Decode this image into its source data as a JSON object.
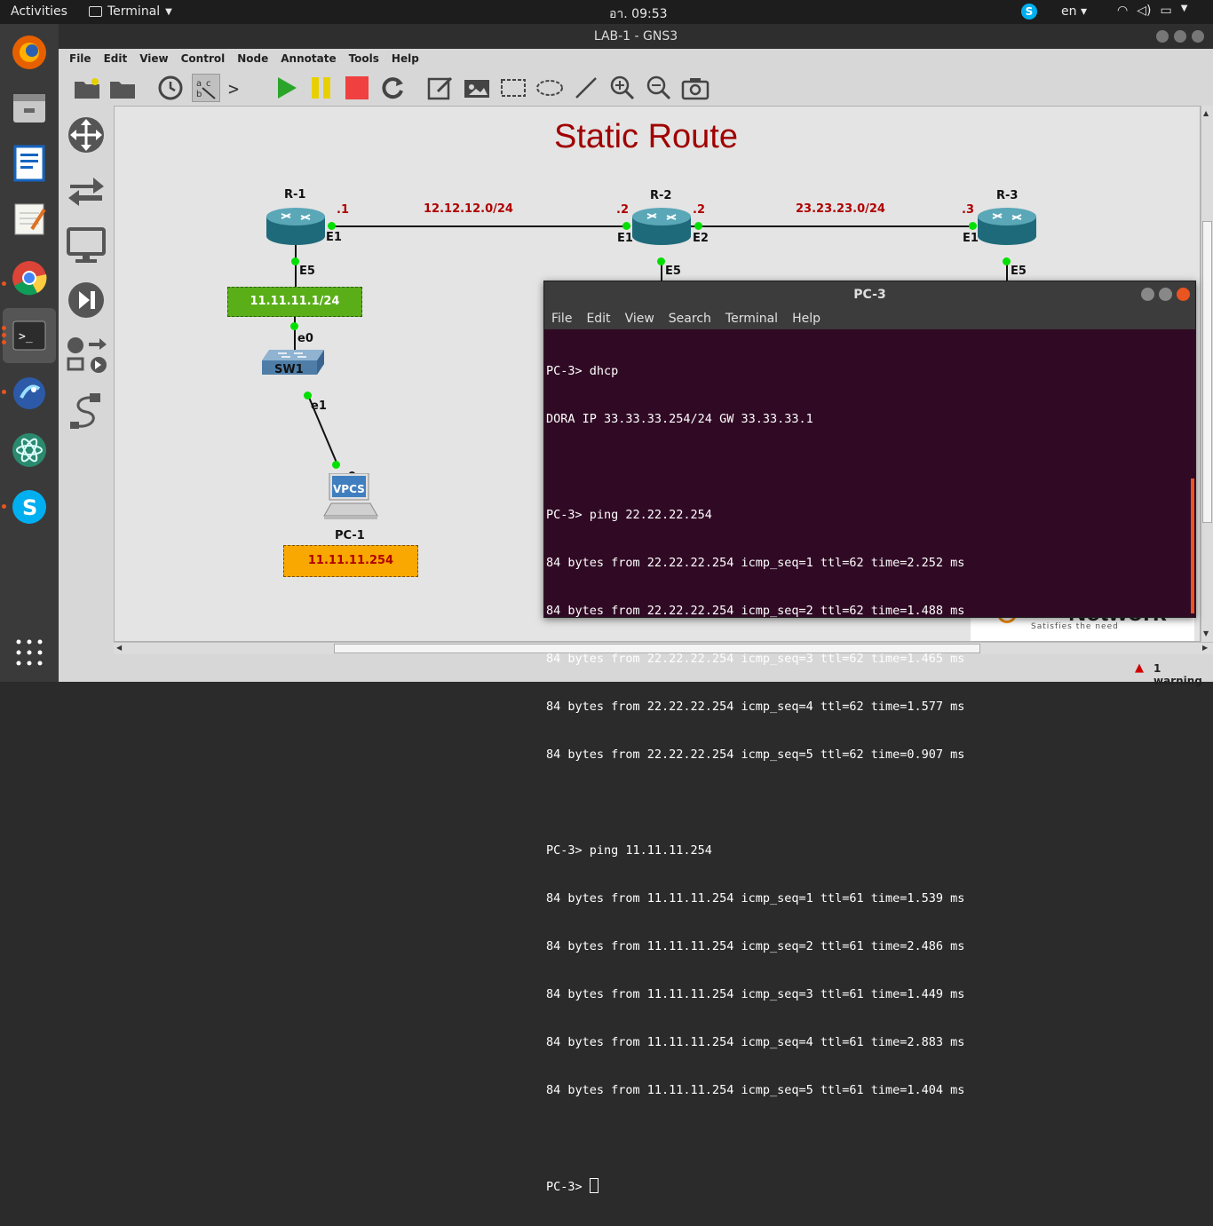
{
  "topbar": {
    "activities": "Activities",
    "app": "Terminal",
    "clock": "อา. 09:53",
    "lang": "en"
  },
  "gns": {
    "title": "LAB-1 - GNS3",
    "menu": [
      "File",
      "Edit",
      "View",
      "Control",
      "Node",
      "Annotate",
      "Tools",
      "Help"
    ],
    "status_warning": "1 warning"
  },
  "topology": {
    "title": "Static Route",
    "routers": [
      "R-1",
      "R-2",
      "R-3"
    ],
    "networks": [
      "12.12.12.0/24",
      "23.23.23.0/24"
    ],
    "ips": [
      ".1",
      ".2",
      ".2",
      ".3"
    ],
    "ports": [
      "E1",
      "E5",
      "E1",
      "E2",
      "E5",
      "E1",
      "E5",
      "e0",
      "e1",
      "e0"
    ],
    "switch": "SW1",
    "pc_label": "PC-1",
    "pc_screen": "VPCS",
    "r1_net_note": "11.11.11.1/24",
    "pc1_note": "11.11.11.254",
    "logo_tagline": "Satisfies the need",
    "logo_text": "Network"
  },
  "terminal": {
    "title": "PC-3",
    "menu": [
      "File",
      "Edit",
      "View",
      "Search",
      "Terminal",
      "Help"
    ],
    "lines": [
      "PC-3> dhcp",
      "DORA IP 33.33.33.254/24 GW 33.33.33.1",
      "",
      "PC-3> ping 22.22.22.254",
      "84 bytes from 22.22.22.254 icmp_seq=1 ttl=62 time=2.252 ms",
      "84 bytes from 22.22.22.254 icmp_seq=2 ttl=62 time=1.488 ms",
      "84 bytes from 22.22.22.254 icmp_seq=3 ttl=62 time=1.465 ms",
      "84 bytes from 22.22.22.254 icmp_seq=4 ttl=62 time=1.577 ms",
      "84 bytes from 22.22.22.254 icmp_seq=5 ttl=62 time=0.907 ms",
      "",
      "PC-3> ping 11.11.11.254",
      "84 bytes from 11.11.11.254 icmp_seq=1 ttl=61 time=1.539 ms",
      "84 bytes from 11.11.11.254 icmp_seq=2 ttl=61 time=2.486 ms",
      "84 bytes from 11.11.11.254 icmp_seq=3 ttl=61 time=1.449 ms",
      "84 bytes from 11.11.11.254 icmp_seq=4 ttl=61 time=2.883 ms",
      "84 bytes from 11.11.11.254 icmp_seq=5 ttl=61 time=1.404 ms",
      ""
    ],
    "prompt": "PC-3> "
  },
  "colors": {
    "accent": "#e95420",
    "term_bg": "#300a24",
    "title_red": "#a00000",
    "link_green": "#00e000"
  }
}
